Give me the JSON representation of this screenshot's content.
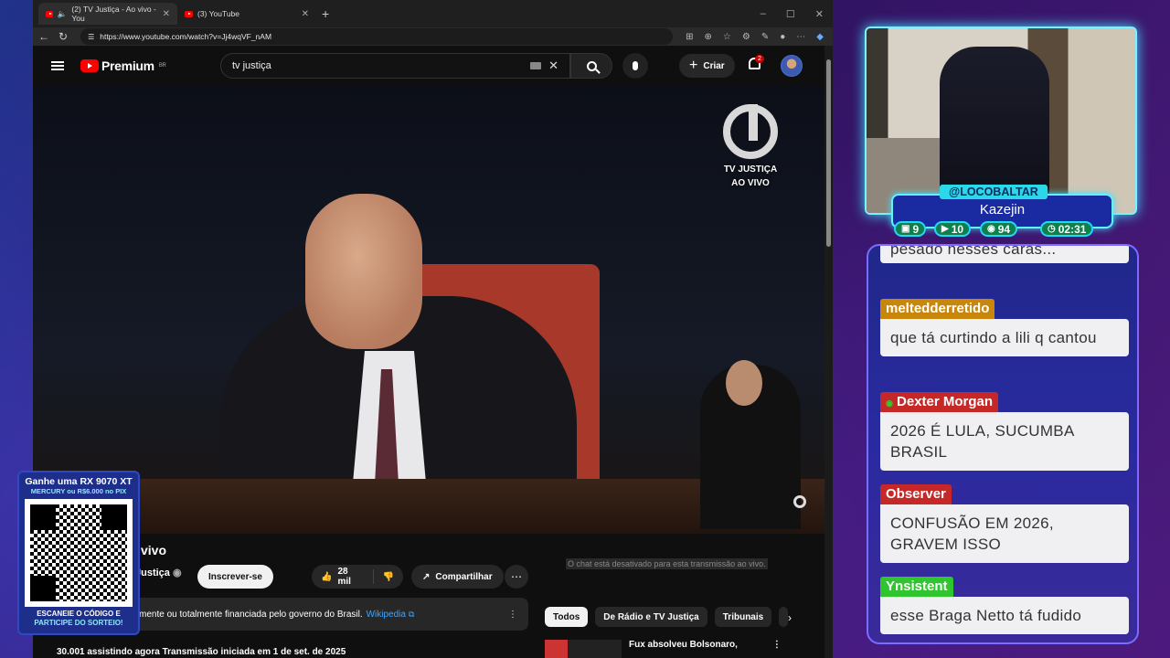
{
  "browser": {
    "tabs": [
      {
        "label": "(2) TV Justiça - Ao vivo - You"
      },
      {
        "label": "(3) YouTube"
      }
    ],
    "url": "https://www.youtube.com/watch?v=Jj4wqVF_nAM"
  },
  "youtube": {
    "brand": "Premium",
    "region": "BR",
    "search_value": "tv justiça",
    "create_label": "Criar",
    "notif_count": "2",
    "video_logo_line1": "TV JUSTIÇA",
    "video_logo_line2": "AO VIVO",
    "video_title": "vivo",
    "channel_name": "Justiça",
    "subscribe_label": "Inscrever-se",
    "likes": "28 mil",
    "share_label": "Compartilhar",
    "notice_text": "mente ou totalmente financiada pelo governo do Brasil.",
    "notice_link": "Wikipedia",
    "stats": "30.001 assistindo agora  Transmissão iniciada em 1 de set. de 2025",
    "chat_disabled": "O chat está desativado para esta transmissão ao vivo.",
    "chips": [
      "Todos",
      "De Rádio e TV Justiça",
      "Tribunais"
    ],
    "rec_title": "Fux absolveu Bolsonaro,"
  },
  "overlay": {
    "qr_line1": "Ganhe uma RX 9070 XT",
    "qr_line2": "MERCURY ou R$6.000 no PIX",
    "qr_line3": "ESCANEIE O CÓDIGO E",
    "qr_line4": "PARTICIPE DO SORTEIO!",
    "handle": "@LOCOBALTAR",
    "streamer": "Kazejin",
    "stats": {
      "twitch": "9",
      "youtube": "10",
      "kick": "94",
      "timer": "02:31"
    }
  },
  "chat": [
    {
      "user": "",
      "text": "pesado nesses caras...",
      "color": "#c62828"
    },
    {
      "user": "meltedderretido",
      "text": "que tá curtindo a lili q cantou",
      "color": "#c8860a"
    },
    {
      "user": "Dexter Morgan",
      "text": "2026 É LULA, SUCUMBA BRASIL",
      "color": "#c62828"
    },
    {
      "user": "Observer",
      "text": "CONFUSÃO EM 2026, GRAVEM ISSO",
      "color": "#c62828"
    },
    {
      "user": "Ynsistent",
      "text": "esse Braga Netto tá fudido",
      "color": "#2ec52e"
    }
  ]
}
